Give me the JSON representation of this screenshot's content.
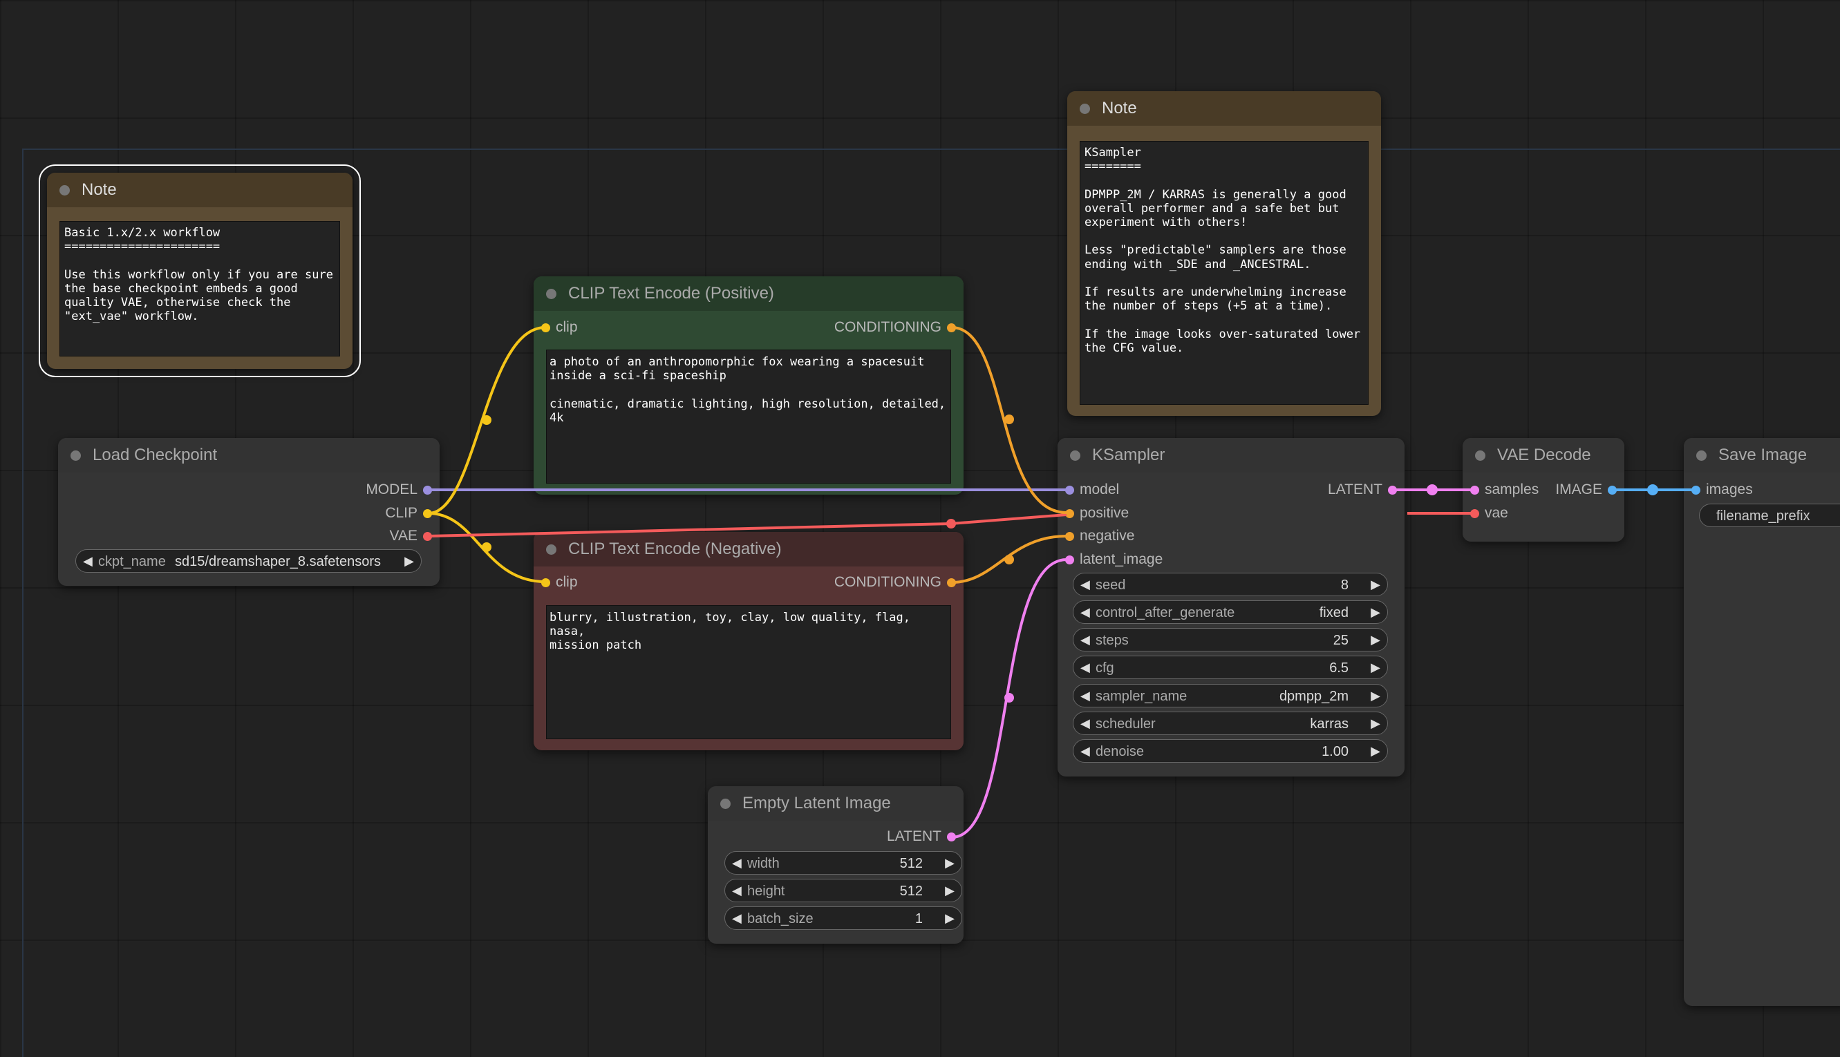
{
  "colors": {
    "model": "#9b8fdf",
    "clip": "#f5c518",
    "vae": "#f45b5b",
    "conditioning": "#f0a02a",
    "latent": "#f080f0",
    "image": "#56aef5",
    "note_bg": "#5c4c34",
    "positive_bg": "#2f4a33",
    "negative_bg": "#573434"
  },
  "note_left": {
    "title": "Note",
    "text": "Basic 1.x/2.x workflow\n======================\n\nUse this workflow only if you are sure\nthe base checkpoint embeds a good\nquality VAE, otherwise check the\n\"ext_vae\" workflow."
  },
  "note_right": {
    "title": "Note",
    "text": "KSampler\n========\n\nDPMPP_2M / KARRAS is generally a good\noverall performer and a safe bet but\nexperiment with others!\n\nLess \"predictable\" samplers are those\nending with _SDE and _ANCESTRAL.\n\nIf results are underwhelming increase\nthe number of steps (+5 at a time).\n\nIf the image looks over-saturated lower\nthe CFG value."
  },
  "load_checkpoint": {
    "title": "Load Checkpoint",
    "outputs": [
      "MODEL",
      "CLIP",
      "VAE"
    ],
    "ckpt_label": "ckpt_name",
    "ckpt_value": "sd15/dreamshaper_8.safetensors"
  },
  "clip_positive": {
    "title": "CLIP Text Encode (Positive)",
    "input": "clip",
    "output": "CONDITIONING",
    "text": "a photo of an anthropomorphic fox wearing a spacesuit\ninside a sci-fi spaceship\n\ncinematic, dramatic lighting, high resolution, detailed,\n4k"
  },
  "clip_negative": {
    "title": "CLIP Text Encode (Negative)",
    "input": "clip",
    "output": "CONDITIONING",
    "text": "blurry, illustration, toy, clay, low quality, flag, nasa,\nmission patch"
  },
  "empty_latent": {
    "title": "Empty Latent Image",
    "output": "LATENT",
    "widgets": [
      {
        "label": "width",
        "value": "512"
      },
      {
        "label": "height",
        "value": "512"
      },
      {
        "label": "batch_size",
        "value": "1"
      }
    ]
  },
  "ksampler": {
    "title": "KSampler",
    "inputs": [
      "model",
      "positive",
      "negative",
      "latent_image"
    ],
    "output": "LATENT",
    "widgets": [
      {
        "label": "seed",
        "value": "8"
      },
      {
        "label": "control_after_generate",
        "value": "fixed"
      },
      {
        "label": "steps",
        "value": "25"
      },
      {
        "label": "cfg",
        "value": "6.5"
      },
      {
        "label": "sampler_name",
        "value": "dpmpp_2m"
      },
      {
        "label": "scheduler",
        "value": "karras"
      },
      {
        "label": "denoise",
        "value": "1.00"
      }
    ]
  },
  "vae_decode": {
    "title": "VAE Decode",
    "inputs": [
      "samples",
      "vae"
    ],
    "output": "IMAGE"
  },
  "save_image": {
    "title": "Save Image",
    "input": "images",
    "filename_label": "filename_prefix"
  }
}
